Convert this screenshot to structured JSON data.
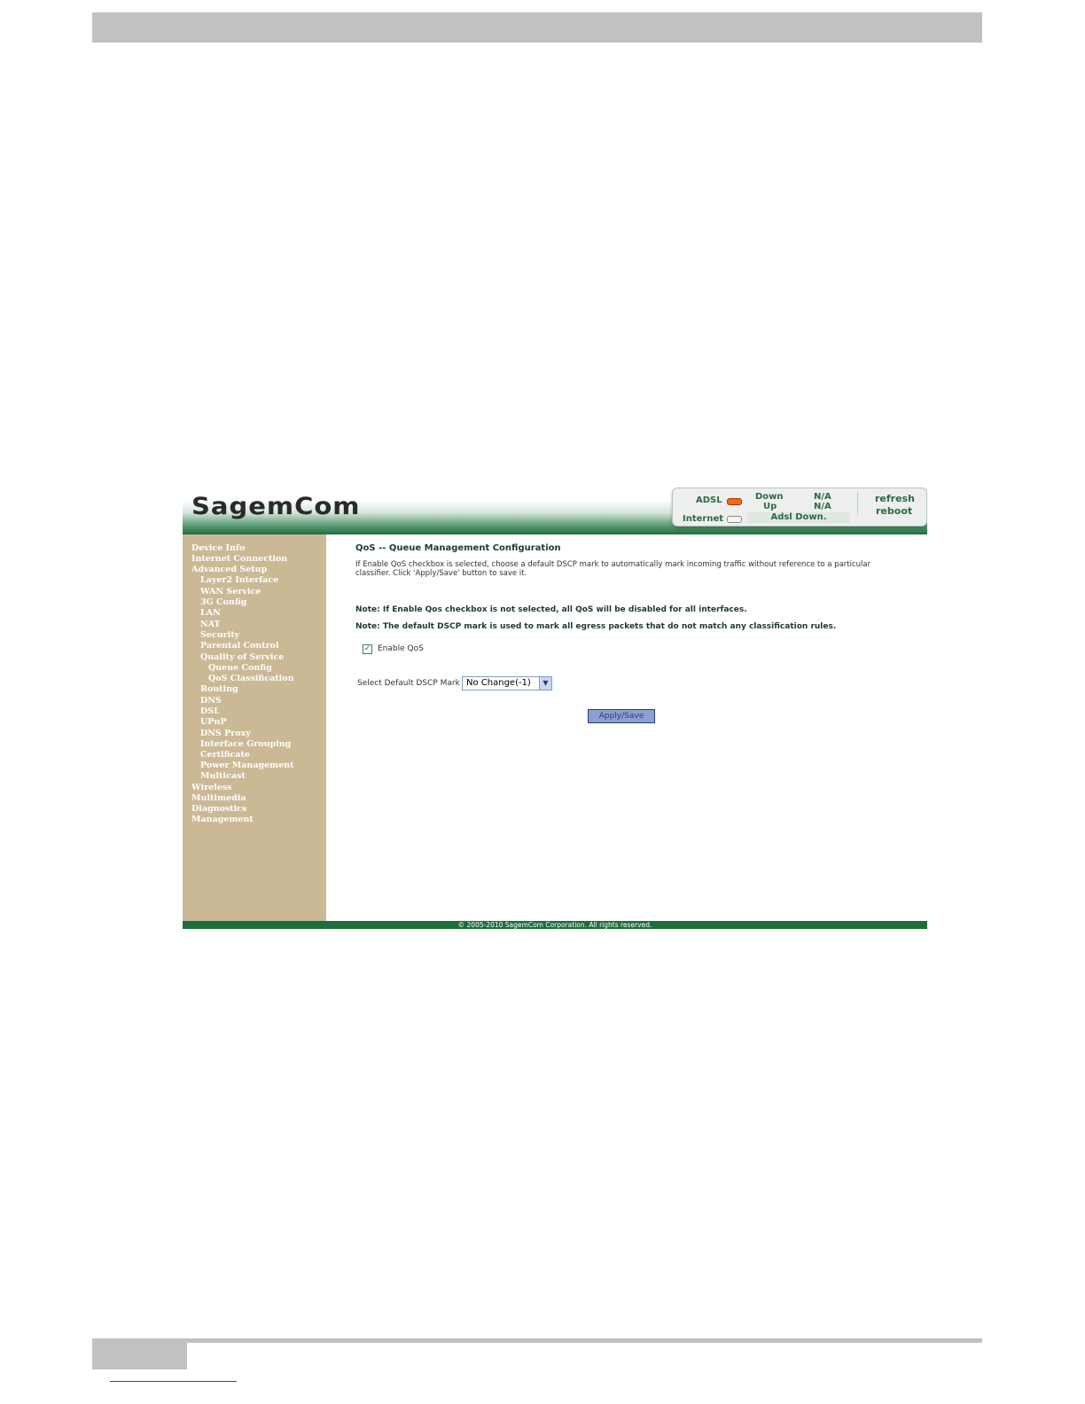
{
  "header": {
    "logo": "SagemCom",
    "status": {
      "adsl_label": "ADSL",
      "internet_label": "Internet",
      "down_label": "Down",
      "up_label": "Up",
      "down_value": "N/A",
      "up_value": "N/A",
      "adsl_status": "Adsl Down.",
      "refresh": "refresh",
      "reboot": "reboot",
      "adsl_led_color": "#f06a1c",
      "internet_led_color": "#f4f4f4"
    }
  },
  "sidebar": {
    "items": [
      {
        "label": "Device Info",
        "level": 0
      },
      {
        "label": "Internet Connection",
        "level": 0
      },
      {
        "label": "Advanced Setup",
        "level": 0
      },
      {
        "label": "Layer2 Interface",
        "level": 1
      },
      {
        "label": "WAN Service",
        "level": 1
      },
      {
        "label": "3G Config",
        "level": 1
      },
      {
        "label": "LAN",
        "level": 1
      },
      {
        "label": "NAT",
        "level": 1
      },
      {
        "label": "Security",
        "level": 1
      },
      {
        "label": "Parental Control",
        "level": 1
      },
      {
        "label": "Quality of Service",
        "level": 1
      },
      {
        "label": "Queue Config",
        "level": 2
      },
      {
        "label": "QoS Classification",
        "level": 2
      },
      {
        "label": "Routing",
        "level": 1
      },
      {
        "label": "DNS",
        "level": 1
      },
      {
        "label": "DSL",
        "level": 1
      },
      {
        "label": "UPnP",
        "level": 1
      },
      {
        "label": "DNS Proxy",
        "level": 1
      },
      {
        "label": "Interface Grouping",
        "level": 1
      },
      {
        "label": "Certificate",
        "level": 1
      },
      {
        "label": "Power Management",
        "level": 1
      },
      {
        "label": "Multicast",
        "level": 1
      },
      {
        "label": "Wireless",
        "level": 0
      },
      {
        "label": "Multimedia",
        "level": 0
      },
      {
        "label": "Diagnostics",
        "level": 0
      },
      {
        "label": "Management",
        "level": 0
      }
    ]
  },
  "main": {
    "title": "QoS -- Queue Management Configuration",
    "description": "If Enable QoS checkbox is selected, choose a default DSCP mark to automatically mark incoming traffic without reference to a particular classifier. Click 'Apply/Save' button to save it.",
    "note1": "Note: If Enable Qos checkbox is not selected, all QoS will be disabled for all interfaces.",
    "note2": "Note: The default DSCP mark is used to mark all egress packets that do not match any classification rules.",
    "enable_qos_label": "Enable QoS",
    "enable_qos_checked": "✓",
    "dscp_label": "Select Default DSCP Mark",
    "dscp_selected": "No Change(-1)",
    "apply_label": "Apply/Save"
  },
  "footer": {
    "copyright": "© 2005-2010 SagemCom Corporation. All rights reserved."
  }
}
